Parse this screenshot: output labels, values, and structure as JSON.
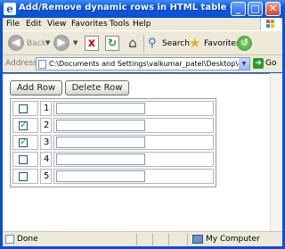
{
  "window": {
    "title": "Add/Remove dynamic rows in HTML table - Microsoft Inte...",
    "title_icon": "ie-icon"
  },
  "menu": {
    "items": [
      "File",
      "Edit",
      "View",
      "Favorites",
      "Tools",
      "Help"
    ]
  },
  "toolbar": {
    "back_label": "Back",
    "search_label": "Search",
    "favorites_label": "Favorites"
  },
  "address": {
    "label": "Address",
    "url": "C:\\Documents and Settings\\valkumar_patel\\Desktop\\dynamic-add",
    "go_label": "Go"
  },
  "page": {
    "add_row_label": "Add Row",
    "delete_row_label": "Delete Row",
    "rows": [
      {
        "checked": false,
        "number": "1",
        "value": ""
      },
      {
        "checked": true,
        "number": "2",
        "value": ""
      },
      {
        "checked": true,
        "number": "3",
        "value": ""
      },
      {
        "checked": false,
        "number": "4",
        "value": ""
      },
      {
        "checked": false,
        "number": "5",
        "value": ""
      }
    ]
  },
  "status": {
    "text": "Done",
    "zone": "My Computer"
  }
}
